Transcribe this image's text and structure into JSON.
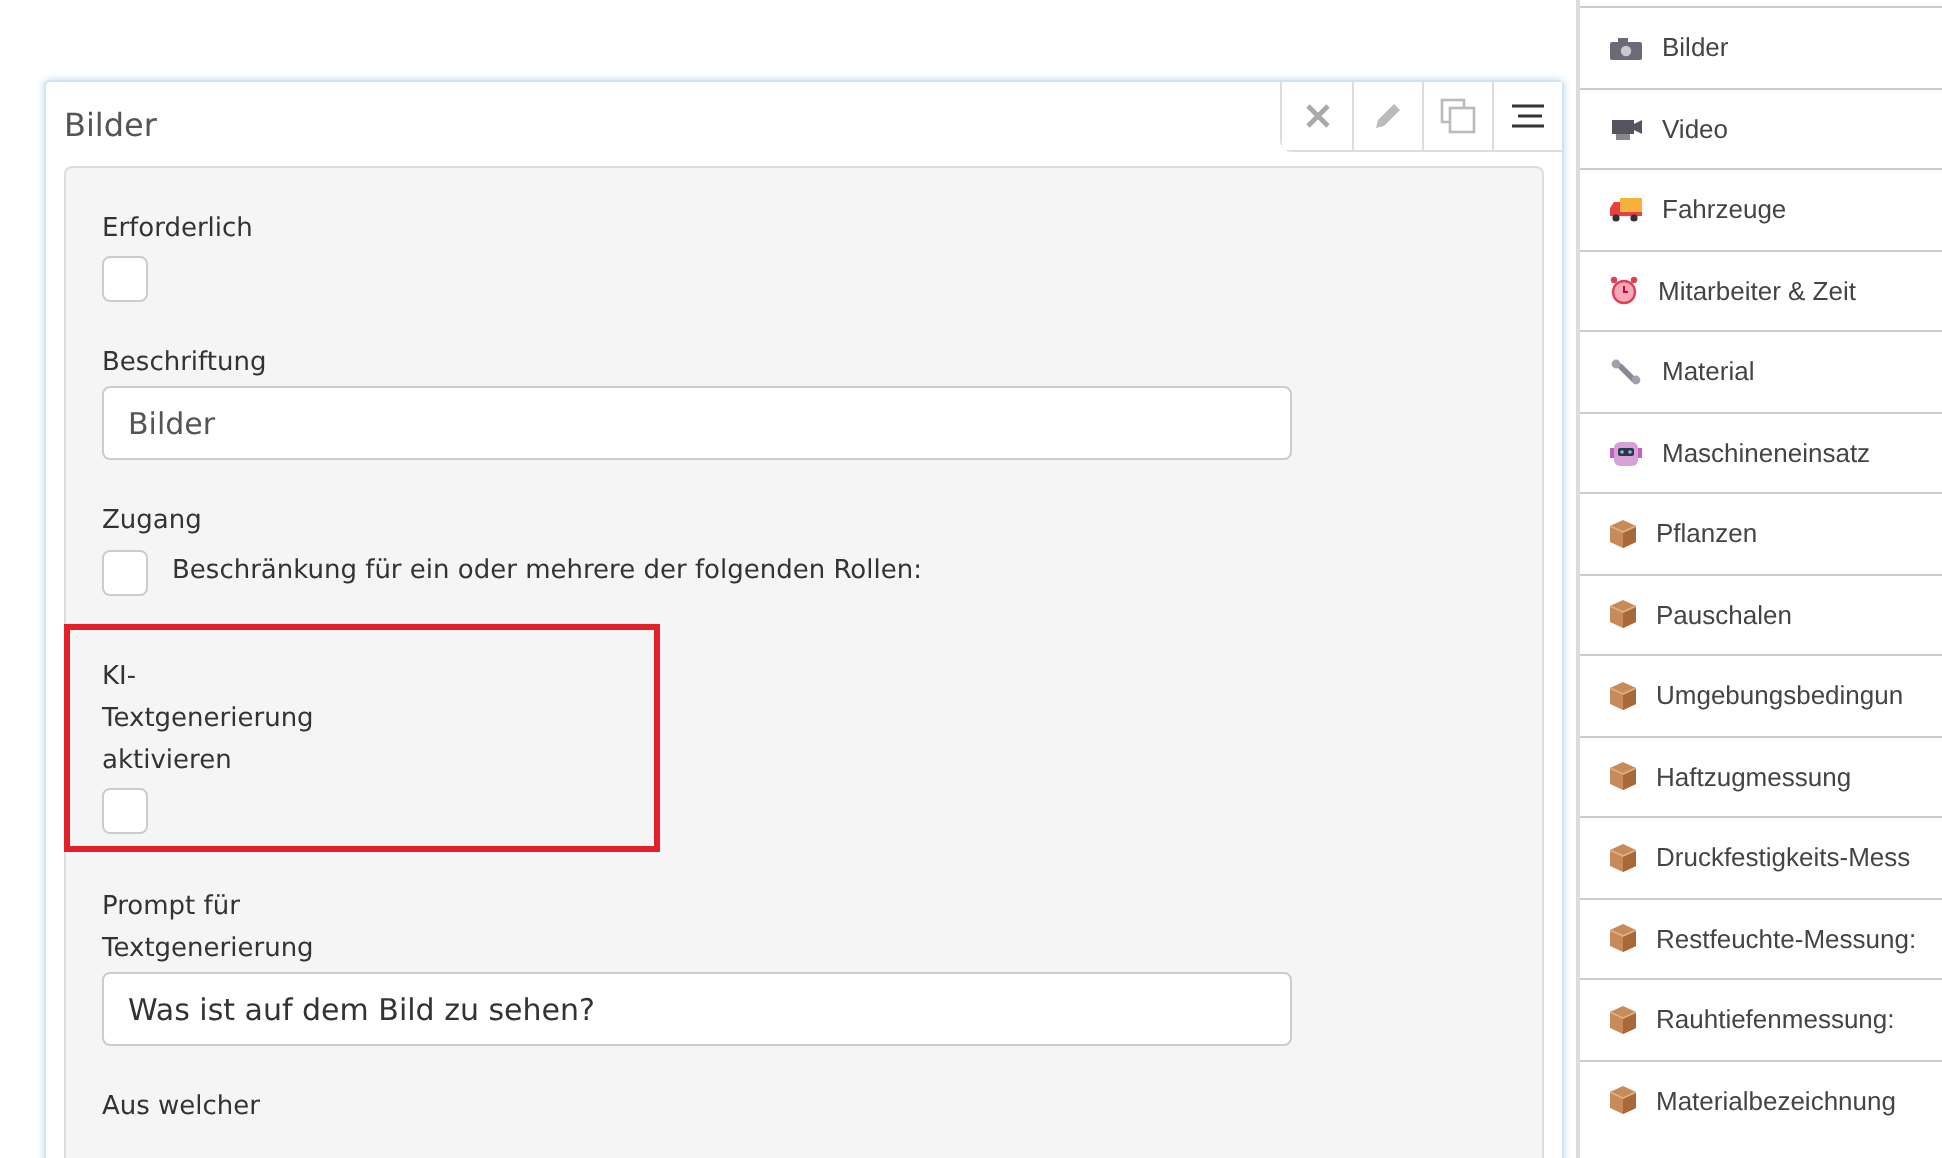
{
  "panel": {
    "title": "Bilder",
    "tools": [
      {
        "kind": "close"
      },
      {
        "kind": "edit"
      },
      {
        "kind": "copy"
      },
      {
        "kind": "menu"
      }
    ]
  },
  "fields": [
    {
      "kind": "checkbox",
      "label": "Erforderlich",
      "checked": false,
      "highlighted": false
    },
    {
      "kind": "text",
      "label": "Beschriftung",
      "placeholder": "Bilder"
    },
    {
      "kind": "checkrow",
      "label": "Zugang",
      "option": "Beschränkung für ein oder mehrere der folgenden Rollen:",
      "checked": false
    },
    {
      "kind": "checkbox",
      "label": "KI-\nTextgenerierung\naktivieren",
      "checked": false,
      "highlighted": true
    },
    {
      "kind": "text",
      "label": "Prompt für\nTextgenerierung",
      "value": "Was ist auf dem Bild zu sehen?"
    },
    {
      "kind": "label",
      "label": "Aus welcher"
    }
  ],
  "sidebar": {
    "items": [
      {
        "kind": "camera",
        "label": "Bilder"
      },
      {
        "kind": "video",
        "label": "Video"
      },
      {
        "kind": "truck",
        "label": "Fahrzeuge"
      },
      {
        "kind": "clock",
        "label": "Mitarbeiter & Zeit"
      },
      {
        "kind": "wrench",
        "label": "Material"
      },
      {
        "kind": "robot",
        "label": "Maschineneinsatz"
      },
      {
        "kind": "box",
        "label": "Pflanzen"
      },
      {
        "kind": "box",
        "label": "Pauschalen"
      },
      {
        "kind": "box",
        "label": "Umgebungsbedingun"
      },
      {
        "kind": "box",
        "label": "Haftzugmessung"
      },
      {
        "kind": "box",
        "label": "Druckfestigkeits-Mess"
      },
      {
        "kind": "box",
        "label": "Restfeuchte-Messung:"
      },
      {
        "kind": "box",
        "label": "Rauhtiefenmessung:"
      },
      {
        "kind": "box",
        "label": "Materialbezeichnung"
      }
    ]
  }
}
